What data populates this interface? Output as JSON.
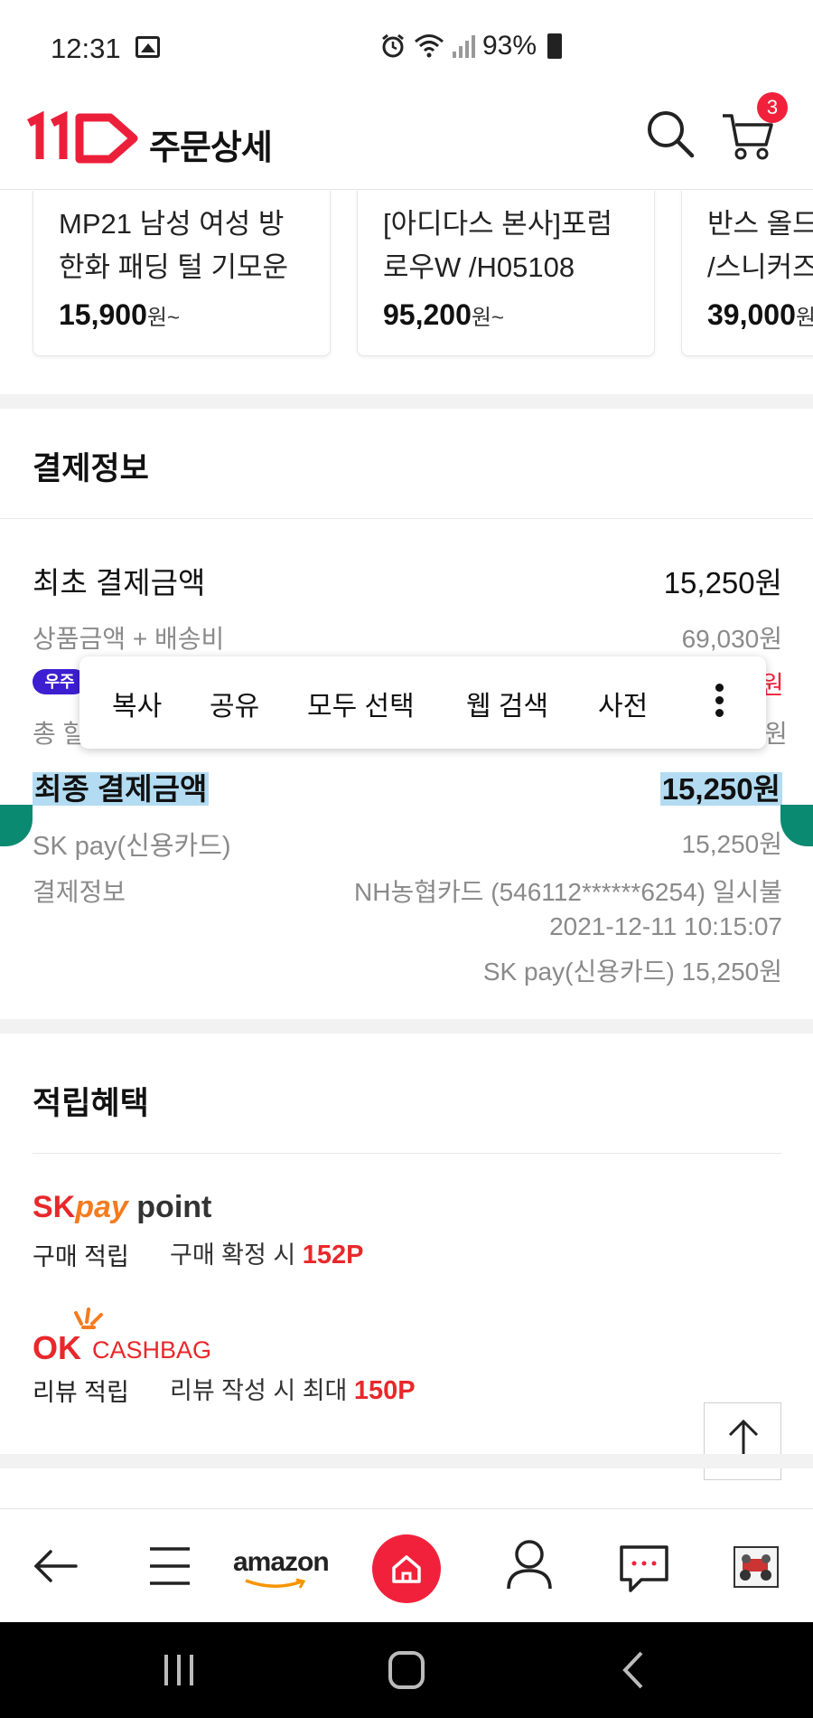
{
  "status_bar": {
    "time": "12:31",
    "battery": "93%"
  },
  "header": {
    "title": "주문상세",
    "cart_count": "3"
  },
  "recommended": [
    {
      "name_line1": "MP21 남성 여성 방",
      "name_line2": "한화 패딩 털 기모운",
      "price": "15,900",
      "unit": "원~"
    },
    {
      "name_line1": "[아디다스 본사]포럼",
      "name_line2": "로우W /H05108",
      "price": "95,200",
      "unit": "원~"
    },
    {
      "name_line1": "반스 올드",
      "name_line2": "/스니커즈",
      "price": "39,000",
      "unit": "원"
    }
  ],
  "payment": {
    "title": "결제정보",
    "initial_label": "최초 결제금액",
    "initial_value": "15,250원",
    "goods_label": "상품금액 + 배송비",
    "goods_value": "69,030원",
    "coupon_badge": "우주",
    "coupon_value_frag": "원",
    "total_discount_frag": "총 할",
    "total_discount_value_frag": "원",
    "final_label": "최종 결제금액",
    "final_value": "15,250원",
    "method_label": "SK pay(신용카드)",
    "method_value": "15,250원",
    "info_label": "결제정보",
    "info_card": "NH농협카드 (546112******6254) 일시불",
    "info_date": "2021-12-11 10:15:07",
    "info_method": "SK pay(신용카드) 15,250원"
  },
  "context_menu": {
    "copy": "복사",
    "share": "공유",
    "select_all": "모두 선택",
    "web_search": "웹 검색",
    "dictionary": "사전"
  },
  "rewards": {
    "title": "적립혜택",
    "skpay_sk": "SK",
    "skpay_pay": "pay",
    "skpay_point": "point",
    "purchase_label": "구매 적립",
    "purchase_desc": "구매 확정 시",
    "purchase_points": "152P",
    "okcashbag_ok": "OK",
    "okcashbag_text": "CASHBAG",
    "review_label": "리뷰 적립",
    "review_desc": "리뷰 작성 시 최대",
    "review_points": "150P"
  },
  "bottom_nav": {
    "amazon": "amazon"
  }
}
